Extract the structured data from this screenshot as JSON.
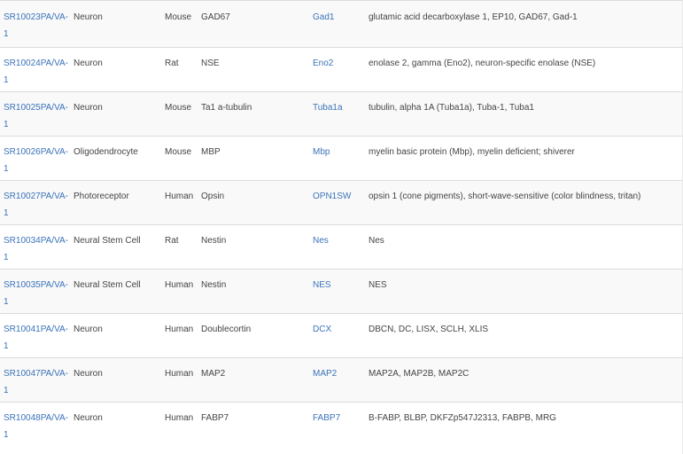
{
  "table": {
    "rows": [
      {
        "catalog": "SR10023PA/VA-1",
        "cell_type": "Neuron",
        "species": "Mouse",
        "antigen": "GAD67",
        "gene": "Gad1",
        "aliases": "glutamic acid decarboxylase 1, EP10, GAD67, Gad-1"
      },
      {
        "catalog": "SR10024PA/VA-1",
        "cell_type": "Neuron",
        "species": "Rat",
        "antigen": "NSE",
        "gene": "Eno2",
        "aliases": "enolase 2, gamma (Eno2), neuron-specific enolase (NSE)"
      },
      {
        "catalog": "SR10025PA/VA-1",
        "cell_type": "Neuron",
        "species": "Mouse",
        "antigen": "Ta1 a-tubulin",
        "gene": "Tuba1a",
        "aliases": "tubulin, alpha 1A (Tuba1a), Tuba-1, Tuba1"
      },
      {
        "catalog": "SR10026PA/VA-1",
        "cell_type": "Oligodendrocyte",
        "species": "Mouse",
        "antigen": "MBP",
        "gene": "Mbp",
        "aliases": "myelin basic protein (Mbp), myelin deficient; shiverer"
      },
      {
        "catalog": "SR10027PA/VA-1",
        "cell_type": "Photoreceptor",
        "species": "Human",
        "antigen": "Opsin",
        "gene": "OPN1SW",
        "aliases": "opsin 1 (cone pigments), short-wave-sensitive (color blindness, tritan)"
      },
      {
        "catalog": "SR10034PA/VA-1",
        "cell_type": "Neural Stem Cell",
        "species": "Rat",
        "antigen": "Nestin",
        "gene": "Nes",
        "aliases": "Nes"
      },
      {
        "catalog": "SR10035PA/VA-1",
        "cell_type": "Neural Stem Cell",
        "species": "Human",
        "antigen": "Nestin",
        "gene": "NES",
        "aliases": "NES"
      },
      {
        "catalog": "SR10041PA/VA-1",
        "cell_type": "Neuron",
        "species": "Human",
        "antigen": "Doublecortin",
        "gene": "DCX",
        "aliases": "DBCN, DC, LISX, SCLH, XLIS"
      },
      {
        "catalog": "SR10047PA/VA-1",
        "cell_type": "Neuron",
        "species": "Human",
        "antigen": "MAP2",
        "gene": "MAP2",
        "aliases": "MAP2A, MAP2B, MAP2C"
      },
      {
        "catalog": "SR10048PA/VA-1",
        "cell_type": "Neuron",
        "species": "Human",
        "antigen": "FABP7",
        "gene": "FABP7",
        "aliases": "B-FABP, BLBP, DKFZp547J2313, FABPB, MRG"
      }
    ]
  },
  "colors": {
    "link": "#3b73b9",
    "text": "#444444",
    "row_alt": "#f9f9f9",
    "border": "#dcdcdc"
  }
}
